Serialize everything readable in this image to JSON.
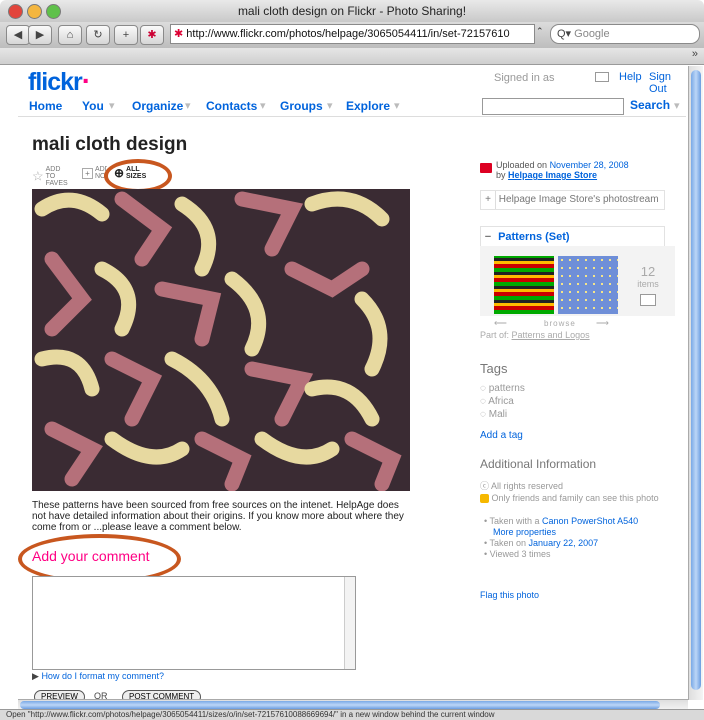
{
  "window": {
    "title": "mali cloth design on Flickr - Photo Sharing!",
    "url": "http://www.flickr.com/photos/helpage/3065054411/in/set-72157610",
    "search_placeholder": "Google",
    "status": "Open \"http://www.flickr.com/photos/helpage/3065054411/sizes/o/in/set-72157610088669694/\" in a new window behind the current window"
  },
  "header": {
    "logo": "flickr",
    "signed_in": "Signed in as",
    "help": "Help",
    "signout": "Sign Out",
    "nav": [
      "Home",
      "You",
      "Organize",
      "Contacts",
      "Groups",
      "Explore"
    ],
    "search_label": "Search"
  },
  "photo": {
    "title": "mali cloth design",
    "add_to_faves": "ADD TO FAVES",
    "add_note": "ADD NOTE",
    "all_sizes": "ALL SIZES",
    "description": "These patterns have been sourced from free sources on the intenet. HelpAge does not have detailed information about their origins. If you know more about where they come from or ...please leave a comment below."
  },
  "comment": {
    "heading": "Add your comment",
    "format_help": "How do I format my comment?",
    "preview": "PREVIEW",
    "or": "OR",
    "post": "POST COMMENT"
  },
  "sidebar": {
    "uploaded_prefix": "Uploaded on",
    "uploaded_date": "November 28, 2008",
    "by_prefix": "by",
    "uploader": "Helpage Image Store",
    "photostream": "Helpage Image Store's photostream",
    "set_title": "Patterns (Set)",
    "set_count": "12",
    "set_count_label": "items",
    "browse": "browse",
    "part_of_prefix": "Part of:",
    "part_of": "Patterns and Logos",
    "tags_heading": "Tags",
    "tags": [
      "patterns",
      "Africa",
      "Mali"
    ],
    "add_tag": "Add a tag",
    "additional_heading": "Additional Information",
    "rights": "All rights reserved",
    "privacy": "Only friends and family can see this photo",
    "taken_with_prefix": "Taken with a",
    "camera": "Canon PowerShot A540",
    "more_props": "More properties",
    "taken_on_prefix": "Taken on",
    "taken_on": "January 22, 2007",
    "viewed": "Viewed 3 times",
    "flag": "Flag this photo"
  },
  "colors": {
    "link": "#0063dc",
    "pink": "#ff0084",
    "annotation": "#c8571f"
  }
}
